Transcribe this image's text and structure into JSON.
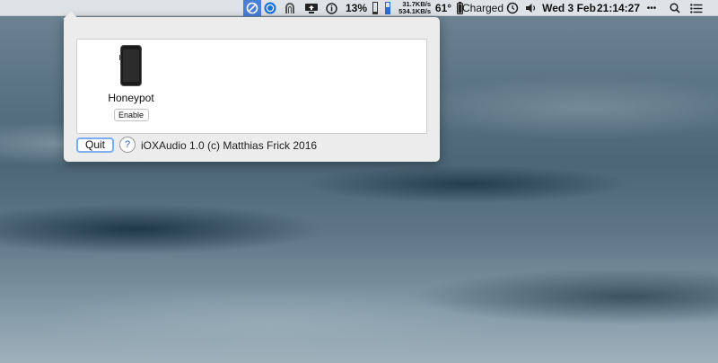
{
  "menubar": {
    "net_up": "31.7KB/s",
    "net_down": "534.1KB/s",
    "temperature": "61°",
    "cpu_percent": "13%",
    "battery_status": "Charged",
    "date": "Wed 3 Feb",
    "time": "21:14:27",
    "more": "•••",
    "highlight_color": "#4a7fd6"
  },
  "popover": {
    "device": {
      "name": "Honeypot",
      "button": "Enable"
    },
    "quit_label": "Quit",
    "help_label": "?",
    "credits": "iOXAudio 1.0 (c) Matthias Frick 2016"
  }
}
